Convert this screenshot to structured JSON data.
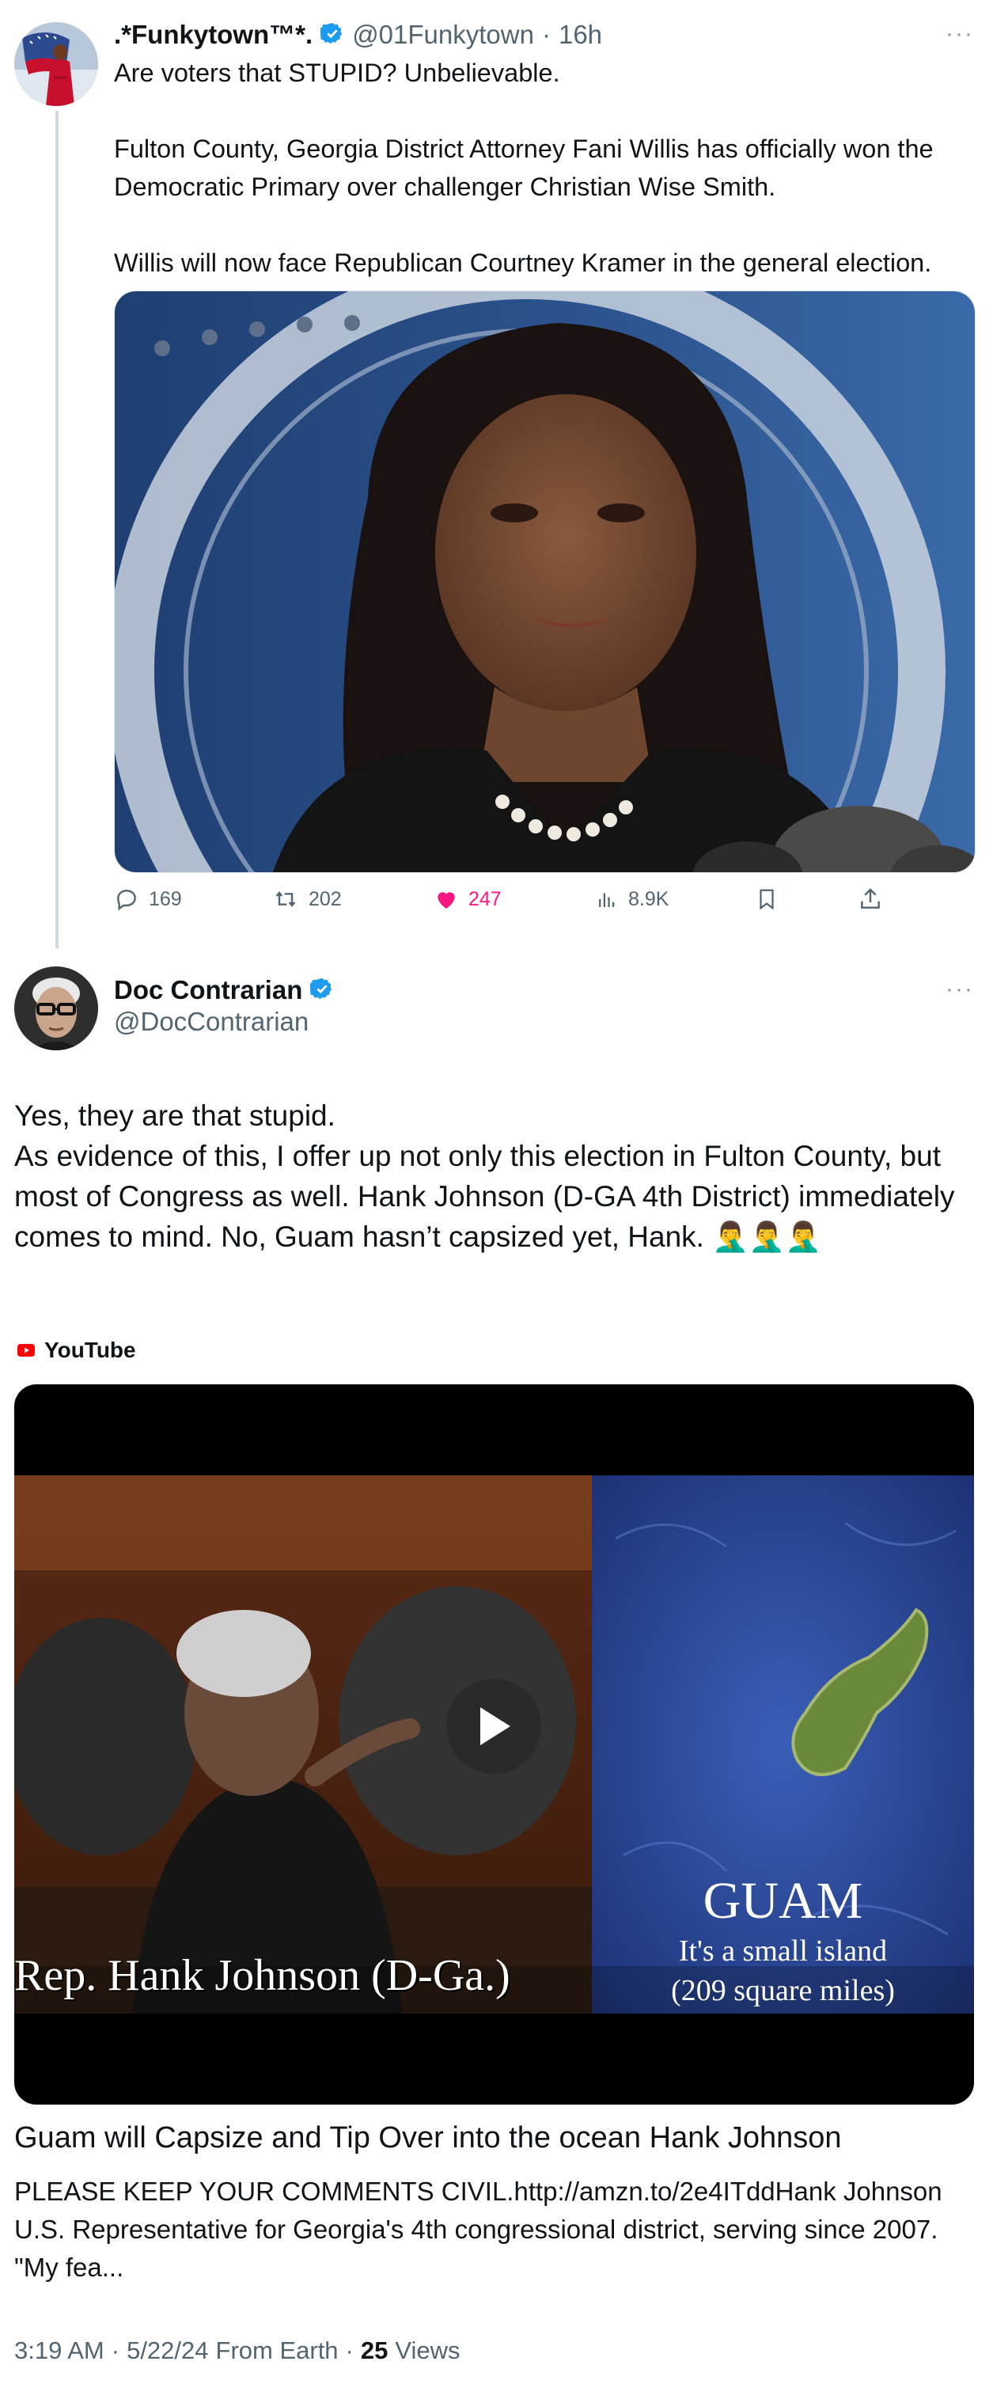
{
  "parent_tweet": {
    "author_name": ".*Funkytown™*.",
    "handle": "@01Funkytown",
    "separator": "·",
    "time": "16h",
    "text": "Are voters that STUPID? Unbelievable.\n\nFulton County, Georgia District Attorney Fani Willis has officially won the Democratic Primary over challenger Christian Wise Smith.\n\nWillis will now face Republican Courtney Kramer in the general election.",
    "actions": {
      "replies": "169",
      "retweets": "202",
      "likes": "247",
      "views": "8.9K"
    },
    "more_icon": "···"
  },
  "reply_tweet": {
    "author_name": "Doc Contrarian",
    "handle": "@DocContrarian",
    "more_icon": "···",
    "text": "Yes, they are that stupid.\nAs evidence of this, I offer up not only this election in Fulton County, but most of Congress as well. Hank Johnson (D-GA 4th District) immediately comes to mind. No, Guam hasn’t capsized yet, Hank. 🤦‍♂️🤦‍♂️🤦‍♂️",
    "card": {
      "source": "YouTube",
      "video_caption_left": "Rep. Hank Johnson (D-Ga.)",
      "video_caption_right_title": "GUAM",
      "video_caption_right_line1": "It's a small island",
      "video_caption_right_line2": "(209 square miles)",
      "title": "Guam will Capsize and Tip Over into the ocean Hank Johnson",
      "description": "PLEASE KEEP YOUR COMMENTS CIVIL.http://amzn.to/2e4ITddHank Johnson U.S. Representative for Georgia's 4th congressional district, serving since 2007. \"My fea..."
    },
    "footer": {
      "time": "3:19 AM",
      "sep1": "·",
      "date": "5/22/24",
      "source": "From Earth",
      "sep2": "·",
      "views_count": "25",
      "views_label": "Views"
    }
  },
  "colors": {
    "like_pink": "#f91880",
    "verified_blue": "#1d9bf0",
    "muted_gray": "#536471",
    "youtube_red": "#ff0000"
  }
}
